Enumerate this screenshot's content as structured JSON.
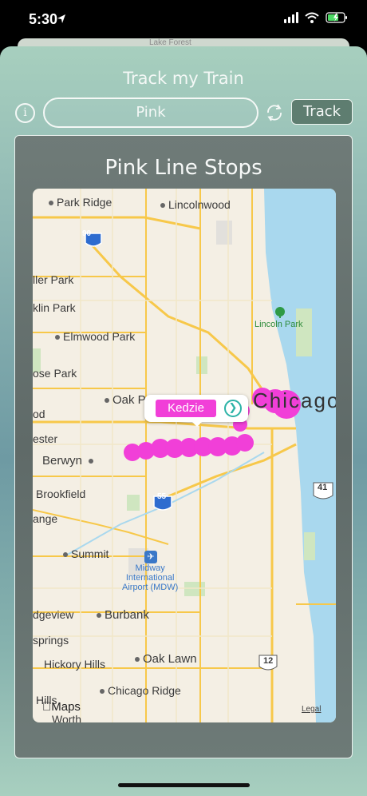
{
  "status_bar": {
    "time": "5:30"
  },
  "background_card": {
    "peek_label": "Lake Forest"
  },
  "header": {
    "title": "Track my Train",
    "line_value": "Pink",
    "track_label": "Track"
  },
  "panel": {
    "title": "Pink Line Stops",
    "map": {
      "places": [
        "Park Ridge",
        "Lincolnwood",
        "ller Park",
        "klin Park",
        "Elmwood Park",
        "ose Park",
        "Oak Park",
        "od",
        "ester",
        "Berwyn",
        "Brookfield",
        "ange",
        "Summit",
        "Burbank",
        "dgeview",
        "springs",
        "Hickory Hills",
        "Oak Lawn",
        "Chicago Ridge",
        "Hills",
        "Worth",
        "Chicago"
      ],
      "poi_lincoln_park": "Lincoln Park",
      "poi_midway": [
        "Midway",
        "International",
        "Airport (MDW)"
      ],
      "shields": [
        "90",
        "55",
        "41",
        "12"
      ],
      "selected_stop": "Kedzie",
      "attribution": "Maps",
      "legal": "Legal"
    }
  },
  "colors": {
    "pink_line": "#f13fd8",
    "track_button": "#5e7d70",
    "lake": "#a9d8ee"
  }
}
